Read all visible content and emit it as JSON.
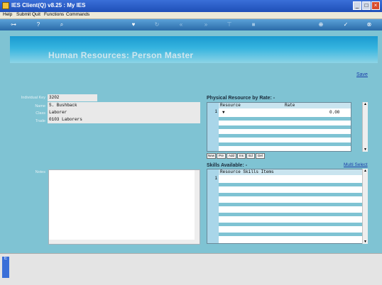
{
  "window": {
    "title": "IES Client(Q) v8.25 : My IES"
  },
  "menu": [
    "Help",
    "Submit",
    "Quit",
    "Functions",
    "Commands"
  ],
  "toolbar": {
    "icons": [
      "key-icon",
      "help-icon",
      "search-icon",
      "heart-icon",
      "refresh-icon",
      "rewind-icon",
      "fast-forward-icon",
      "bookmark-icon",
      "square-icon",
      "add-icon",
      "check-icon",
      "close-icon"
    ]
  },
  "page": {
    "title": "Human Resources: Person Master",
    "save_label": "Save"
  },
  "form": {
    "individual_key": {
      "label": "Individual Key",
      "value": "3202"
    },
    "name": {
      "label": "Name",
      "value": "S. Bushback"
    },
    "class": {
      "label": "Class",
      "value": "Laborer"
    },
    "trade": {
      "label": "Trade",
      "value": "0103 Laborers"
    },
    "notes": {
      "label": "Notes",
      "value": ""
    }
  },
  "physical_resource": {
    "title": "Physical Resource by Rate: -",
    "columns": [
      "Resource",
      "Rate"
    ],
    "rows": [
      {
        "num": "1",
        "resource": "▼",
        "rate": "0.00"
      }
    ],
    "buttons": [
      "New",
      "Pre",
      "Add",
      "Ins",
      "Ed",
      "Del"
    ]
  },
  "skills": {
    "title": "Skills Available: -",
    "multi_select_label": "Multi Select",
    "columns": [
      "Resource Skills Items"
    ],
    "rows": [
      {
        "num": "1"
      }
    ]
  },
  "colors": {
    "accent": "#7fc3d3",
    "banner": "#1a9ad0"
  }
}
